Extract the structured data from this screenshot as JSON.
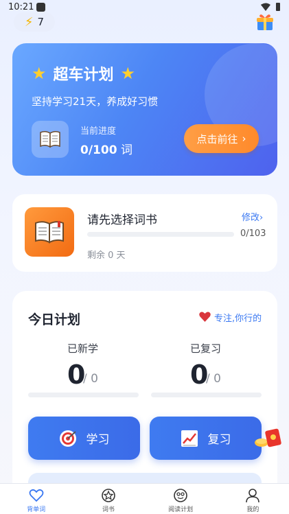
{
  "status_bar": {
    "time": "10:21"
  },
  "top": {
    "energy_count": "7"
  },
  "hero": {
    "title": "超车计划",
    "subtitle": "坚持学习21天，养成好习惯",
    "progress_label": "当前进度",
    "progress_value": "0/100",
    "progress_unit": "词",
    "go_button": "点击前往",
    "go_arrow": "›"
  },
  "wordbook": {
    "title": "请先选择词书",
    "modify": "修改",
    "modify_arrow": "›",
    "count": "0/103",
    "remaining": "剩余 0 天",
    "progress": 0
  },
  "plan": {
    "title": "今日计划",
    "motto": "专注,你行的",
    "new_label": "已新学",
    "new_count": "0",
    "new_total": "/ 0",
    "review_label": "已复习",
    "review_count": "0",
    "review_total": "/ 0",
    "study_button": "学习",
    "review_button": "复习"
  },
  "nav": {
    "items": [
      {
        "label": "背单词",
        "icon": "heart-icon",
        "active": true
      },
      {
        "label": "词书",
        "icon": "star-circle-icon",
        "active": false
      },
      {
        "label": "阅读计划",
        "icon": "reading-icon",
        "active": false
      },
      {
        "label": "我的",
        "icon": "user-icon",
        "active": false
      }
    ]
  },
  "colors": {
    "accent": "#3a78f2",
    "hero_start": "#6aa8ff",
    "hero_end": "#4e62ee",
    "orange": "#ff8a2b"
  }
}
